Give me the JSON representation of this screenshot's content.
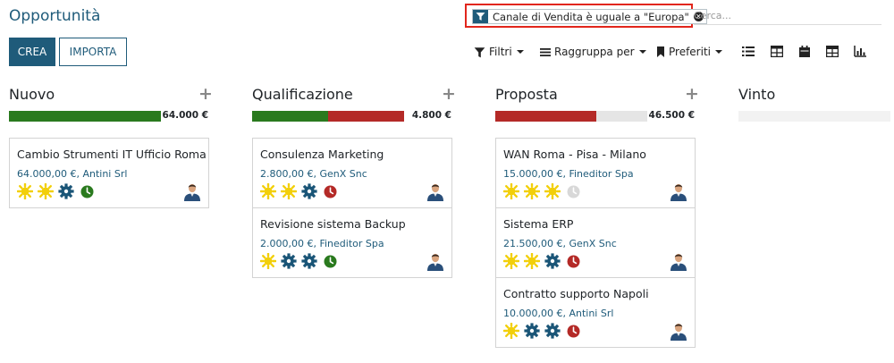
{
  "header": {
    "title": "Opportunità",
    "facet_label": "Canale di Vendita è uguale a \"Europa\"",
    "search_placeholder": "Cerca..."
  },
  "buttons": {
    "create_label": "CREA",
    "import_label": "IMPORTA"
  },
  "toolbar": {
    "filters_label": "Filtri",
    "groupby_label": "Raggruppa per",
    "favorites_label": "Preferiti",
    "views": [
      "list-view-icon",
      "kanban-view-icon",
      "calendar-view-icon",
      "pivot-view-icon",
      "graph-view-icon"
    ]
  },
  "colors": {
    "primary": "#1f5b7a",
    "green": "#2a7a1e",
    "red": "#b42a27",
    "gray": "#e5e5e5",
    "sun": "#f2cf0a",
    "gear": "#1a5577",
    "highlight": "#e1261c"
  },
  "columns": [
    {
      "title": "Nuovo",
      "total": "64.000 €",
      "progress": [
        {
          "color": "green",
          "fraction": 1.0
        }
      ],
      "cards": [
        {
          "title": "Cambio Strumenti IT Ufficio Roma",
          "subtitle": "64.000,00 €, Antini Srl",
          "icons": [
            "sun",
            "sun",
            "gear"
          ],
          "activity": "green"
        }
      ]
    },
    {
      "title": "Qualificazione",
      "total": "4.800 €",
      "progress": [
        {
          "color": "green",
          "fraction": 0.5
        },
        {
          "color": "red",
          "fraction": 0.5
        }
      ],
      "cards": [
        {
          "title": "Consulenza Marketing",
          "subtitle": "2.800,00 €, GenX Snc",
          "icons": [
            "sun",
            "sun",
            "gear"
          ],
          "activity": "red"
        },
        {
          "title": "Revisione sistema Backup",
          "subtitle": "2.000,00 €, Fineditor Spa",
          "icons": [
            "sun",
            "gear",
            "gear"
          ],
          "activity": "green"
        }
      ]
    },
    {
      "title": "Proposta",
      "total": "46.500 €",
      "progress": [
        {
          "color": "red",
          "fraction": 0.667
        },
        {
          "color": "gray",
          "fraction": 0.333
        }
      ],
      "cards": [
        {
          "title": "WAN Roma - Pisa - Milano",
          "subtitle": "15.000,00 €, Fineditor Spa",
          "icons": [
            "sun",
            "sun",
            "sun"
          ],
          "activity": "gray"
        },
        {
          "title": "Sistema ERP",
          "subtitle": "21.500,00 €, GenX Snc",
          "icons": [
            "sun",
            "sun",
            "gear"
          ],
          "activity": "red"
        },
        {
          "title": "Contratto supporto Napoli",
          "subtitle": "10.000,00 €, Antini Srl",
          "icons": [
            "sun",
            "gear",
            "gear"
          ],
          "activity": "red"
        }
      ]
    },
    {
      "title": "Vinto",
      "total": "",
      "progress": [],
      "cards": []
    }
  ]
}
